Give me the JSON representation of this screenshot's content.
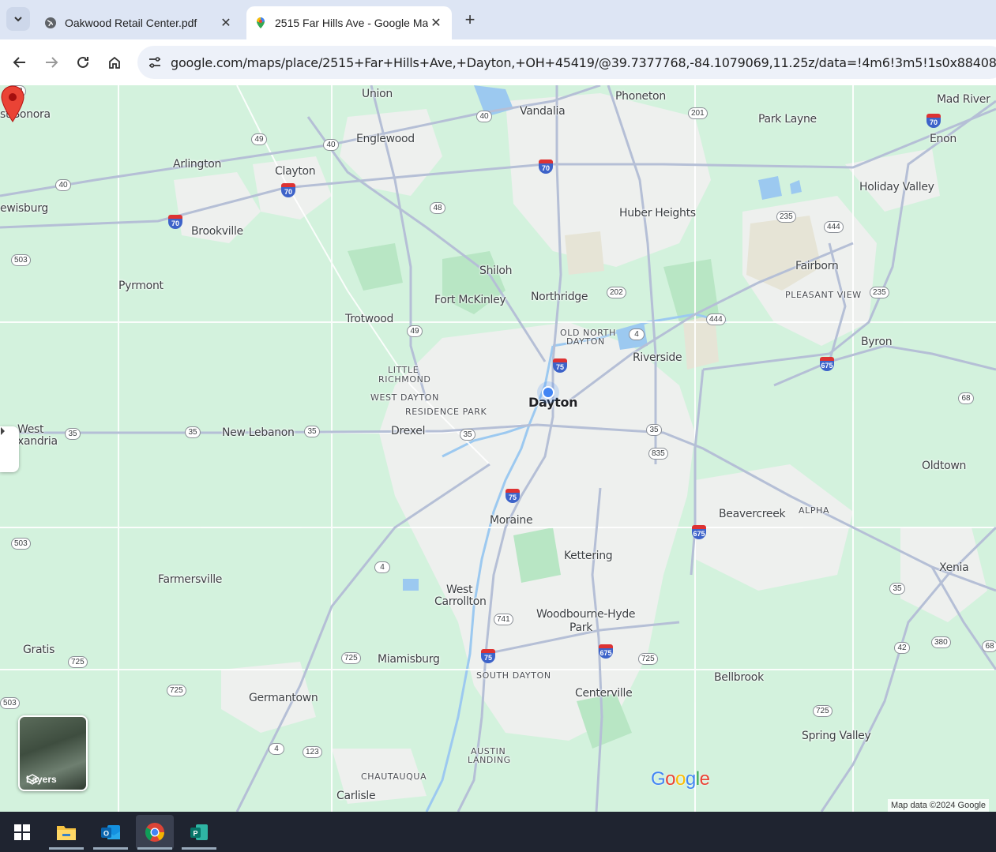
{
  "browser": {
    "tabs": [
      {
        "title": "Oakwood Retail Center.pdf",
        "icon": "globe-icon",
        "active": false
      },
      {
        "title": "2515 Far Hills Ave - Google Ma",
        "icon": "google-maps-icon",
        "active": true
      }
    ],
    "new_tab_label": "+",
    "url": "google.com/maps/place/2515+Far+Hills+Ave,+Dayton,+OH+45419/@39.7377768,-84.1079069,11.25z/data=!4m6!3m5!1s0x884085cc426b99b5:0xf209"
  },
  "map": {
    "places": [
      {
        "name": "Union",
        "cls": ""
      },
      {
        "name": "Vandalia",
        "cls": ""
      },
      {
        "name": "Phoneton",
        "cls": ""
      },
      {
        "name": "Mad River",
        "cls": ""
      },
      {
        "name": "Park Layne",
        "cls": ""
      },
      {
        "name": "Enon",
        "cls": ""
      },
      {
        "name": "st Sonora",
        "cls": ""
      },
      {
        "name": "Englewood",
        "cls": ""
      },
      {
        "name": "Arlington",
        "cls": ""
      },
      {
        "name": "Clayton",
        "cls": ""
      },
      {
        "name": "Holiday Valley",
        "cls": ""
      },
      {
        "name": "ewisburg",
        "cls": ""
      },
      {
        "name": "Huber Heights",
        "cls": ""
      },
      {
        "name": "Brookville",
        "cls": ""
      },
      {
        "name": "Fairborn",
        "cls": ""
      },
      {
        "name": "Shiloh",
        "cls": ""
      },
      {
        "name": "Pyrmont",
        "cls": ""
      },
      {
        "name": "Fort McKinley",
        "cls": ""
      },
      {
        "name": "Northridge",
        "cls": ""
      },
      {
        "name": "PLEASANT VIEW",
        "cls": "small"
      },
      {
        "name": "Trotwood",
        "cls": ""
      },
      {
        "name": "OLD NORTH",
        "cls": "small"
      },
      {
        "name": "DAYTON",
        "cls": "small"
      },
      {
        "name": "Byron",
        "cls": ""
      },
      {
        "name": "Riverside",
        "cls": ""
      },
      {
        "name": "LITTLE",
        "cls": "small"
      },
      {
        "name": "RICHMOND",
        "cls": "small"
      },
      {
        "name": "WEST DAYTON",
        "cls": "small"
      },
      {
        "name": "Dayton",
        "cls": "big"
      },
      {
        "name": "RESIDENCE PARK",
        "cls": "small"
      },
      {
        "name": "West",
        "cls": ""
      },
      {
        "name": "xandria",
        "cls": ""
      },
      {
        "name": "New Lebanon",
        "cls": ""
      },
      {
        "name": "Drexel",
        "cls": ""
      },
      {
        "name": "Oldtown",
        "cls": ""
      },
      {
        "name": "Moraine",
        "cls": ""
      },
      {
        "name": "Beavercreek",
        "cls": ""
      },
      {
        "name": "ALPHA",
        "cls": "small"
      },
      {
        "name": "Kettering",
        "cls": ""
      },
      {
        "name": "Xenia",
        "cls": ""
      },
      {
        "name": "Farmersville",
        "cls": ""
      },
      {
        "name": "West",
        "cls": ""
      },
      {
        "name": "Carrollton",
        "cls": ""
      },
      {
        "name": "Woodbourne-Hyde",
        "cls": ""
      },
      {
        "name": "Park",
        "cls": ""
      },
      {
        "name": "Gratis",
        "cls": ""
      },
      {
        "name": "Miamisburg",
        "cls": ""
      },
      {
        "name": "SOUTH DAYTON",
        "cls": "small"
      },
      {
        "name": "Bellbrook",
        "cls": ""
      },
      {
        "name": "Centerville",
        "cls": ""
      },
      {
        "name": "Germantown",
        "cls": ""
      },
      {
        "name": "Spring Valley",
        "cls": ""
      },
      {
        "name": "AUSTIN",
        "cls": "small"
      },
      {
        "name": "LANDING",
        "cls": "small"
      },
      {
        "name": "CHAUTAUQUA",
        "cls": "small"
      },
      {
        "name": "Carlisle",
        "cls": ""
      }
    ],
    "shields": [
      "503",
      "40",
      "201",
      "49",
      "40",
      "70",
      "40",
      "70",
      "48",
      "235",
      "444",
      "70",
      "503",
      "202",
      "4",
      "444",
      "235",
      "49",
      "75",
      "675",
      "68",
      "35",
      "35",
      "35",
      "35",
      "35",
      "835",
      "75",
      "675",
      "503",
      "4",
      "35",
      "741",
      "725",
      "75",
      "675",
      "725",
      "42",
      "380",
      "68",
      "725",
      "725",
      "503",
      "4",
      "123",
      "725",
      "70"
    ],
    "layers_label": "Layers",
    "google_logo": {
      "letters": [
        "G",
        "o",
        "o",
        "g",
        "l",
        "e"
      ],
      "colors": [
        "#4285f4",
        "#ea4335",
        "#fbbc05",
        "#4285f4",
        "#34a853",
        "#ea4335"
      ]
    },
    "attribution": "Map data ©2024 Google",
    "pin_color": "#ea4335",
    "location_dot_color": "#4285f4"
  },
  "taskbar": {
    "items": [
      {
        "icon": "windows-start-icon"
      },
      {
        "icon": "file-explorer-icon"
      },
      {
        "icon": "outlook-icon"
      },
      {
        "icon": "chrome-icon"
      },
      {
        "icon": "publisher-icon"
      }
    ]
  }
}
